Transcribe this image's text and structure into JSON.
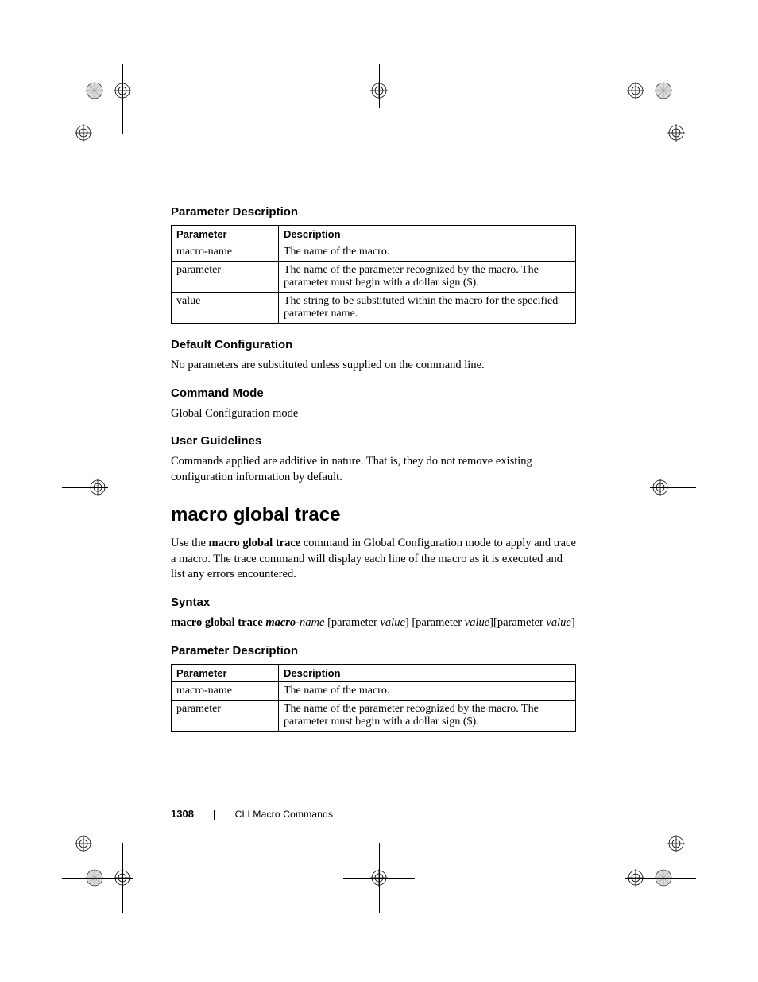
{
  "sections": {
    "param_desc_heading": "Parameter Description",
    "table1": {
      "col1": "Parameter",
      "col2": "Description",
      "rows": [
        {
          "p": "macro-name",
          "d": "The name of the macro."
        },
        {
          "p": "parameter",
          "d": "The name of the parameter recognized by the macro. The parameter must begin with a dollar sign ($)."
        },
        {
          "p": "value",
          "d": "The string to be substituted within the macro for the specified parameter name."
        }
      ]
    },
    "default_cfg_heading": "Default Configuration",
    "default_cfg_body": "No parameters are substituted unless supplied on the command line.",
    "cmd_mode_heading": "Command Mode",
    "cmd_mode_body": "Global Configuration mode",
    "user_guidelines_heading": "User Guidelines",
    "user_guidelines_body": "Commands applied are additive in nature. That is, they do not remove existing configuration information by default.",
    "cmd_heading": "macro global trace",
    "cmd_intro_prefix": "Use the ",
    "cmd_intro_bold": "macro global trace",
    "cmd_intro_suffix": " command in Global Configuration mode to apply and trace a macro. The trace command will display each line of the macro as it is executed and list any errors encountered.",
    "syntax_heading": "Syntax",
    "syntax": {
      "p1": "macro global trace ",
      "p2": "macro-",
      "p3": "name",
      "p4": " [parameter ",
      "p5": "value",
      "p6": "] [parameter ",
      "p7": "value",
      "p8": "][parameter ",
      "p9": "value",
      "p10": "]"
    },
    "param_desc_heading2": "Parameter Description",
    "table2": {
      "col1": "Parameter",
      "col2": "Description",
      "rows": [
        {
          "p": "macro-name",
          "d": "The name of the macro."
        },
        {
          "p": "parameter",
          "d": "The name of the parameter recognized by the macro. The parameter must begin with a dollar sign ($)."
        }
      ]
    }
  },
  "footer": {
    "page_number": "1308",
    "chapter": "CLI Macro Commands"
  }
}
